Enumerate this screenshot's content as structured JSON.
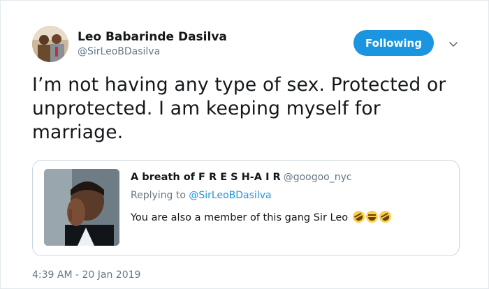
{
  "author": {
    "name": "Leo Babarinde Dasilva",
    "handle": "@SirLeoBDasilva"
  },
  "follow_button": {
    "label": "Following"
  },
  "tweet": {
    "lines": [
      "I’m not having any type of sex. Protected or",
      "unprotected.  I am keeping myself for",
      "marriage."
    ]
  },
  "quoted_tweet": {
    "name": "A breath of F R E S H-A I R",
    "handle": "@googoo_nyc",
    "replying_prefix": "Replying to",
    "replying_handle": "@SirLeoBDasilva",
    "text": "You are also a member of this gang Sir Leo",
    "emojis": [
      "rolling-on-floor-laughing",
      "face-with-tears-of-joy",
      "rolling-on-floor-laughing"
    ]
  },
  "timestamp": "4:39 AM - 20 Jan 2019",
  "colors": {
    "accent": "#1b95e0",
    "secondary_text": "#657786",
    "border": "#ccd6dd"
  }
}
